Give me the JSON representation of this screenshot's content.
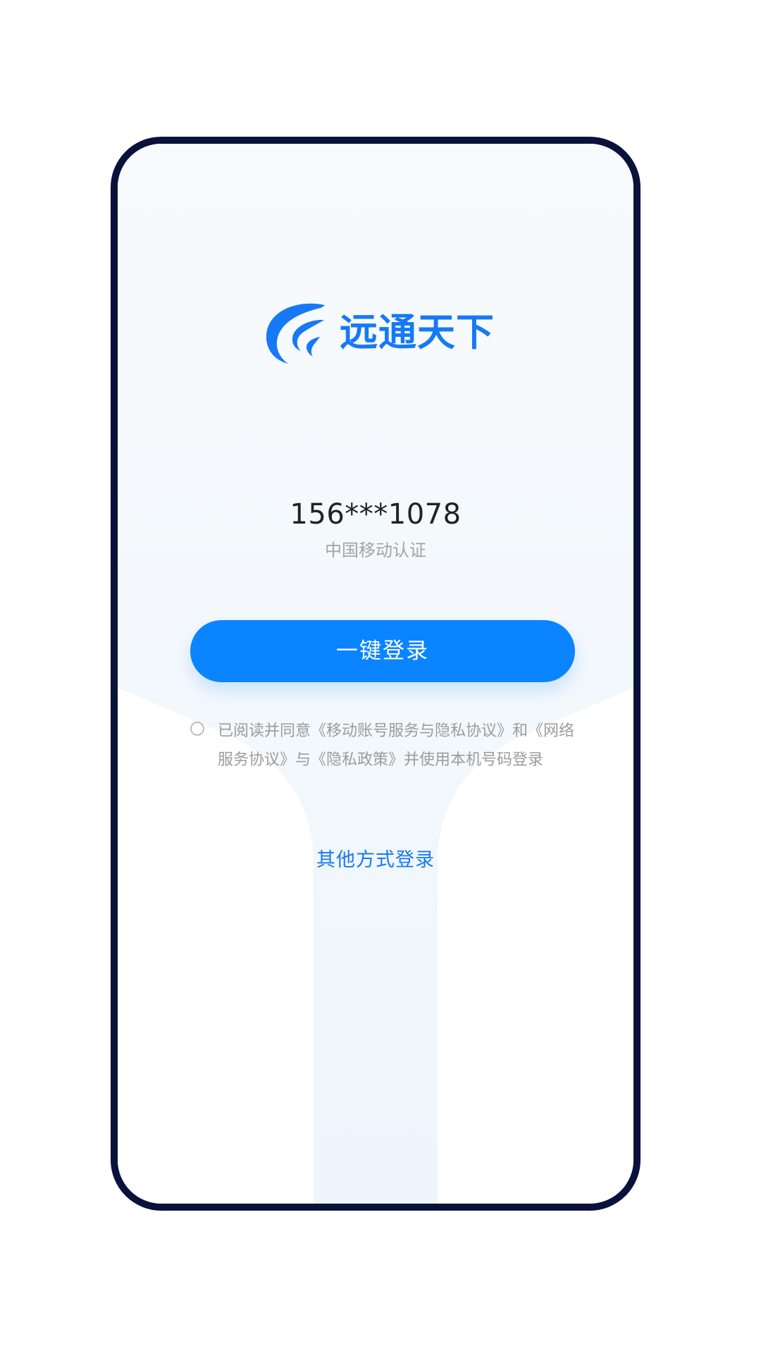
{
  "brand": {
    "name": "远通天下",
    "logo_icon": "brand-wave-icon"
  },
  "login": {
    "phone_masked": "156***1078",
    "carrier_auth": "中国移动认证",
    "one_click_label": "一键登录",
    "agreement_text": "已阅读并同意《移动账号服务与隐私协议》和《网络服务协议》与《隐私政策》并使用本机号码登录",
    "other_methods_label": "其他方式登录"
  },
  "colors": {
    "primary_blue": "#1679f6",
    "button_blue": "#0a84ff",
    "frame_navy": "#08123a",
    "muted_gray": "#a3a3a3",
    "light_blue_bg": "#f2f7fd"
  }
}
